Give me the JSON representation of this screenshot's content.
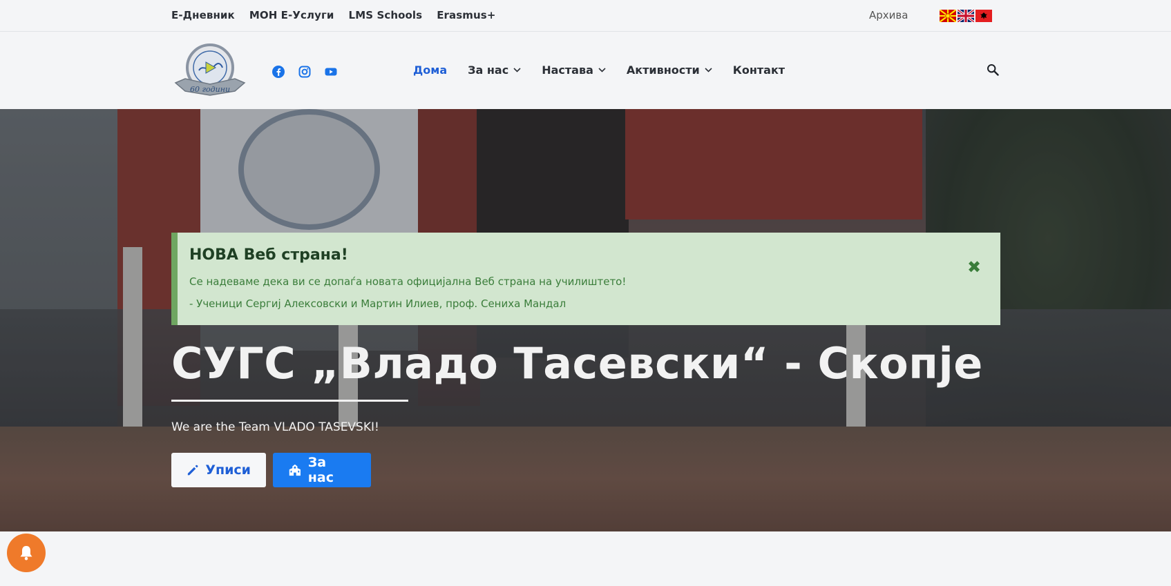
{
  "topbar": {
    "links": [
      "Е-Дневник",
      "МОН Е-Услуги",
      "LMS Schools",
      "Erasmus+"
    ],
    "archive": "Архива",
    "flags": [
      "macedonian-flag-icon",
      "uk-flag-icon",
      "albanian-flag-icon"
    ]
  },
  "header": {
    "logo_text": "60 години",
    "social": [
      "facebook-icon",
      "instagram-icon",
      "youtube-icon"
    ],
    "nav": [
      {
        "label": "Дома",
        "active": true,
        "dropdown": false
      },
      {
        "label": "За нас",
        "active": false,
        "dropdown": true
      },
      {
        "label": "Настава",
        "active": false,
        "dropdown": true
      },
      {
        "label": "Активности",
        "active": false,
        "dropdown": true
      },
      {
        "label": "Контакт",
        "active": false,
        "dropdown": false
      }
    ]
  },
  "alert": {
    "title": "НОВА Веб страна!",
    "line1": "Се надеваме дека ви се допаѓа новата официјална Веб страна на училиштето!",
    "line2": "- Ученици Сергиј Алексовски и Мартин Илиев, проф. Сениха Мандал"
  },
  "hero": {
    "title": "СУГС „Владо Тасевски“ - Скопје",
    "subtitle": "We are the Team VLADO TASEVSKI!",
    "buttons": {
      "enroll": "Уписи",
      "about": "За нас"
    }
  },
  "colors": {
    "accent_blue": "#1a7bf1",
    "nav_active": "#1f5fd6",
    "alert_bg": "#d2e6cf",
    "alert_text": "#3a7d3a",
    "bell": "#ef7a2a"
  }
}
